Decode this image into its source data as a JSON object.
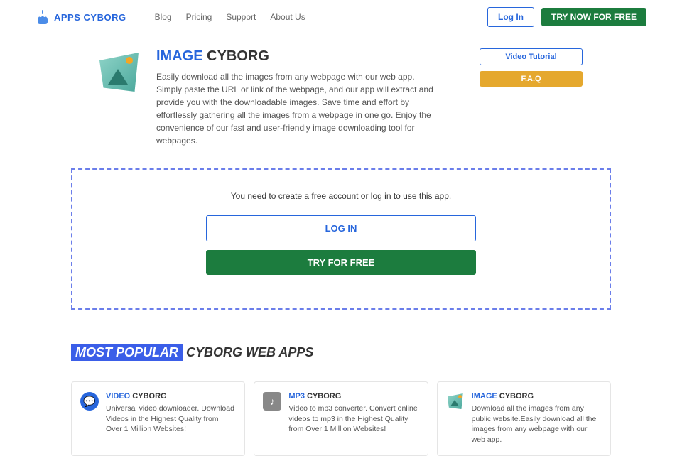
{
  "header": {
    "brand_first": "APPS",
    "brand_second": "CYBORG",
    "nav": [
      "Blog",
      "Pricing",
      "Support",
      "About Us"
    ],
    "login": "Log In",
    "try": "TRY NOW FOR FREE"
  },
  "hero": {
    "title_accent": "IMAGE",
    "title_rest": " CYBORG",
    "desc": "Easily download all the images from any webpage with our web app. Simply paste the URL or link of the webpage, and our app will extract and provide you with the downloadable images. Save time and effort by effortlessly gathering all the images from a webpage in one go. Enjoy the convenience of our fast and user-friendly image downloading tool for webpages.",
    "video_tutorial": "Video Tutorial",
    "faq": "F.A.Q"
  },
  "cta": {
    "text": "You need to create a free account or log in to use this app.",
    "login": "LOG IN",
    "try": "TRY FOR FREE"
  },
  "section": {
    "title_hl": "MOST POPULAR",
    "title_rest": " CYBORG WEB APPS"
  },
  "cards": [
    {
      "accent": "VIDEO",
      "rest": " CYBORG",
      "desc": "Universal video downloader. Download Videos in the Highest Quality from Over 1 Million Websites!"
    },
    {
      "accent": "MP3",
      "rest": " CYBORG",
      "desc": "Video to mp3 converter. Convert online videos to mp3 in the Highest Quality from Over 1 Million Websites!"
    },
    {
      "accent": "IMAGE",
      "rest": " CYBORG",
      "desc": "Download all the images from any public website.Easily download all the images from any webpage with our web app."
    }
  ]
}
